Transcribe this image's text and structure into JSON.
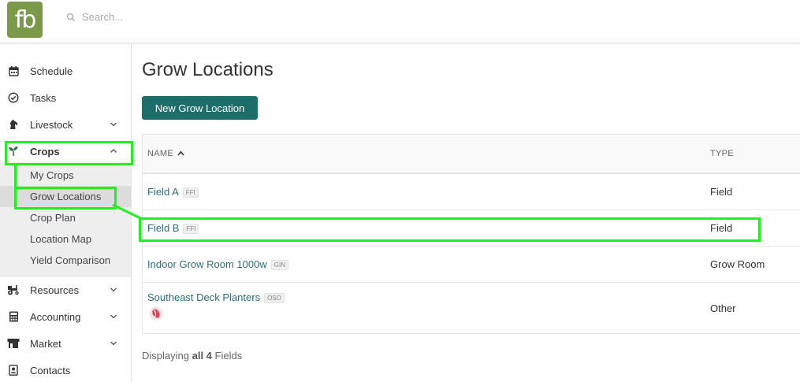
{
  "header": {
    "logo_text": "fb",
    "search_placeholder": "Search..."
  },
  "sidebar": {
    "items": [
      {
        "label": "Schedule",
        "icon": "calendar-icon"
      },
      {
        "label": "Tasks",
        "icon": "check-circle-icon"
      },
      {
        "label": "Livestock",
        "icon": "horse-icon"
      },
      {
        "label": "Crops",
        "icon": "seedling-icon"
      },
      {
        "label": "Resources",
        "icon": "tractor-icon"
      },
      {
        "label": "Accounting",
        "icon": "calculator-icon"
      },
      {
        "label": "Market",
        "icon": "store-icon"
      },
      {
        "label": "Contacts",
        "icon": "contact-card-icon"
      }
    ],
    "crops_sub": [
      "My Crops",
      "Grow Locations",
      "Crop Plan",
      "Location Map",
      "Yield Comparison"
    ]
  },
  "main": {
    "title": "Grow Locations",
    "new_button": "New Grow Location",
    "table": {
      "headers": {
        "name": "NAME",
        "type": "TYPE"
      },
      "rows": [
        {
          "name": "Field A",
          "badge": "FFI",
          "type": "Field"
        },
        {
          "name": "Field B",
          "badge": "FFI",
          "type": "Field"
        },
        {
          "name": "Indoor Grow Room 1000w",
          "badge": "GIN",
          "type": "Grow Room"
        },
        {
          "name": "Southeast Deck Planters",
          "badge": "OSO",
          "type": "Other"
        }
      ]
    },
    "footer": {
      "prefix": "Displaying",
      "count": "all 4",
      "suffix": "Fields"
    }
  },
  "colors": {
    "brand": "#7a9a4a",
    "button": "#1d6e6b",
    "link": "#2c6e78",
    "highlight": "#22ee22"
  }
}
